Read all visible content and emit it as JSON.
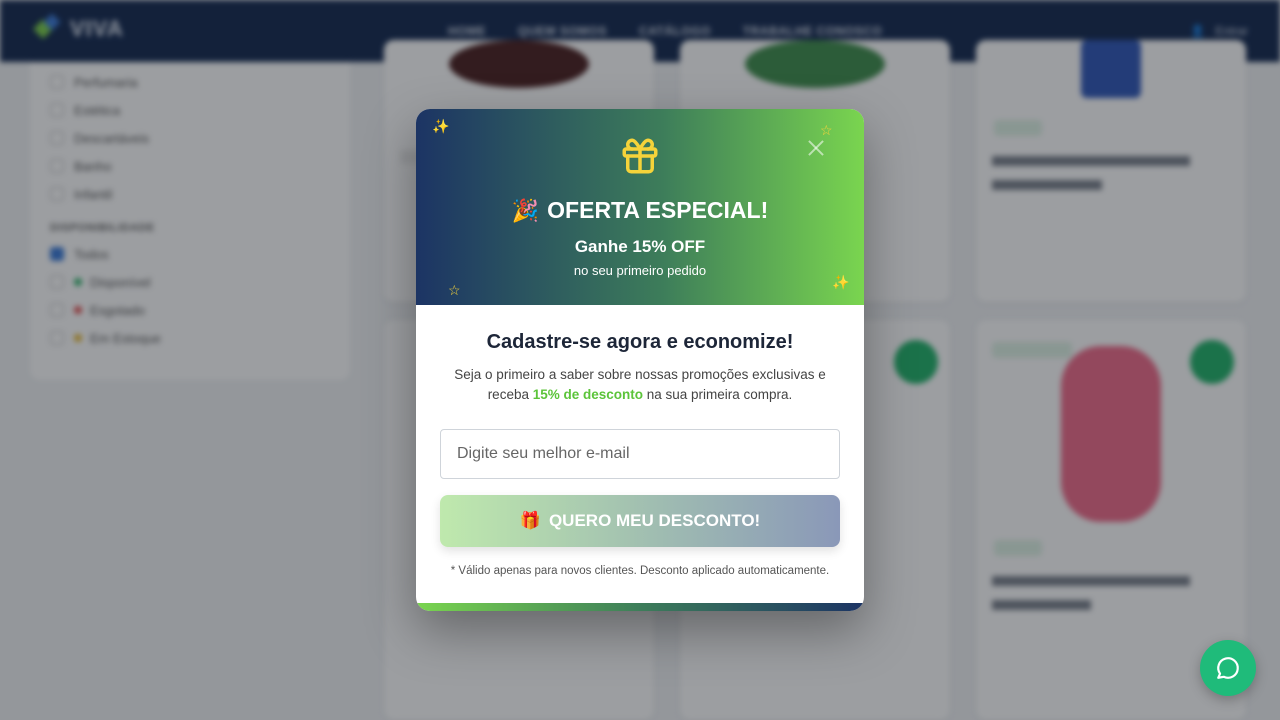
{
  "header": {
    "logo_text": "VIVA",
    "nav": [
      "HOME",
      "QUEM SOMOS",
      "CATÁLOGO",
      "TRABALHE CONOSCO"
    ],
    "account_label": "Entrar"
  },
  "sidebar": {
    "categories": [
      {
        "label": "Perfumaria"
      },
      {
        "label": "Estética"
      },
      {
        "label": "Descartáveis"
      },
      {
        "label": "Banho"
      },
      {
        "label": "Infantil"
      }
    ],
    "availability_title": "DISPONIBILIDADE",
    "availability": [
      {
        "label": "Todos",
        "checked": true,
        "dot": ""
      },
      {
        "label": "Disponível",
        "checked": false,
        "dot": "#2db36a"
      },
      {
        "label": "Esgotado",
        "checked": false,
        "dot": "#e04b4b"
      },
      {
        "label": "Em Estoque",
        "checked": false,
        "dot": "#e6b62c"
      }
    ]
  },
  "modal": {
    "headline": "OFERTA ESPECIAL!",
    "headline_emoji": "🎉",
    "subheadline": "Ganhe 15% OFF",
    "subheadline_small": "no seu primeiro pedido",
    "title": "Cadastre-se agora e economize!",
    "text_before": "Seja o primeiro a saber sobre nossas promoções exclusivas e receba ",
    "text_highlight": "15% de desconto",
    "text_after": " na sua primeira compra.",
    "email_placeholder": "Digite seu melhor e-mail",
    "email_value": "",
    "cta_emoji": "🎁",
    "cta_label": "QUERO MEU DESCONTO!",
    "note": "* Válido apenas para novos clientes. Desconto aplicado automaticamente.",
    "sparkle": "✨",
    "star": "☆"
  },
  "colors": {
    "header_bg": "#13284f",
    "modal_gradient_start": "#1c3464",
    "modal_gradient_end": "#7ad54f",
    "highlight": "#5cc43a",
    "whatsapp": "#1fbb7a"
  }
}
